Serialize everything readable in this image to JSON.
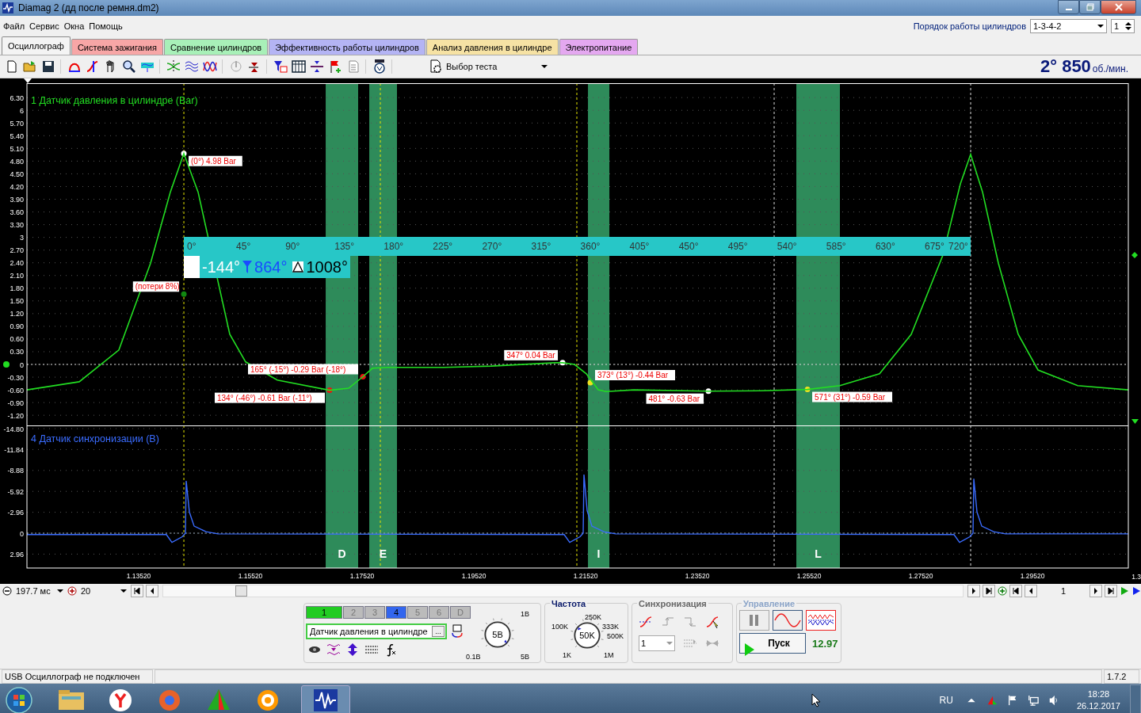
{
  "window": {
    "title": "Diamag 2 (дд после ремня.dm2)"
  },
  "menu": [
    "Файл",
    "Сервис",
    "Окна",
    "Помощь"
  ],
  "cylinder_order": {
    "label": "Порядок работы цилиндров",
    "value": "1-3-4-2",
    "spin_value": "1"
  },
  "tabs": [
    {
      "label": "Осциллограф",
      "selected": true,
      "color": "#f4f4f4"
    },
    {
      "label": "Система зажигания",
      "selected": false,
      "color": "#f7a6a6"
    },
    {
      "label": "Сравнение цилиндров",
      "selected": false,
      "color": "#a8f0b8"
    },
    {
      "label": "Эффективность работы цилиндров",
      "selected": false,
      "color": "#b4b4f4"
    },
    {
      "label": "Анализ давления в цилиндре",
      "selected": false,
      "color": "#f6e2a4"
    },
    {
      "label": "Электропитание",
      "selected": false,
      "color": "#e4a8f0"
    }
  ],
  "toolbar": {
    "test_select": "Выбор теста",
    "angle": "2°",
    "rpm": "850",
    "rpm_unit": "об./мин."
  },
  "scope": {
    "pressure": {
      "chart_data": {
        "type": "line",
        "title": "1 Датчик давления в цилиндре (Bar)",
        "xlim": [
          1.1152,
          1.31236
        ],
        "ylim": [
          -1.44,
          6.64
        ],
        "grid": true,
        "x": [
          1.1152,
          1.12456,
          1.13165,
          1.13733,
          1.14087,
          1.14329,
          1.14584,
          1.1473,
          1.15151,
          1.15435,
          1.16002,
          1.16938,
          1.17279,
          1.17534,
          1.17704,
          1.17988,
          1.18981,
          1.19832,
          1.20967,
          1.21109,
          1.21321,
          1.21534,
          1.21747,
          1.21889,
          1.22385,
          1.23719,
          1.24655,
          1.25492,
          1.26073,
          1.26782,
          1.2735,
          1.27917,
          1.28229,
          1.28414,
          1.28626,
          1.2891,
          1.29265,
          1.29619,
          1.30329,
          1.31236
        ],
        "series": [
          {
            "color": "#22dd22",
            "values": [
              -0.6,
              -0.41,
              0.34,
              2.39,
              4.07,
              4.98,
              4.07,
              3.2,
              0.71,
              0.06,
              -0.37,
              -0.61,
              -0.56,
              -0.29,
              -0.09,
              -0.07,
              -0.07,
              -0.04,
              0.04,
              0.04,
              0,
              -0.22,
              -0.6,
              -0.64,
              -0.6,
              -0.63,
              -0.62,
              -0.59,
              -0.5,
              -0.22,
              0.71,
              2.58,
              4.26,
              4.96,
              4.07,
              2.39,
              0.71,
              -0.13,
              -0.5,
              -0.6
            ]
          }
        ],
        "yticks": [
          {
            "value": 6.3,
            "label": "6.30"
          },
          {
            "value": 6,
            "label": "6"
          },
          {
            "value": 5.7,
            "label": "5.70"
          },
          {
            "value": 5.4,
            "label": "5.40"
          },
          {
            "value": 5.1,
            "label": "5.10"
          },
          {
            "value": 4.8,
            "label": "4.80"
          },
          {
            "value": 4.5,
            "label": "4.50"
          },
          {
            "value": 4.2,
            "label": "4.20"
          },
          {
            "value": 3.9,
            "label": "3.90"
          },
          {
            "value": 3.6,
            "label": "3.60"
          },
          {
            "value": 3.3,
            "label": "3.30"
          },
          {
            "value": 3,
            "label": "3"
          },
          {
            "value": 2.7,
            "label": "2.70"
          },
          {
            "value": 2.4,
            "label": "2.40"
          },
          {
            "value": 2.1,
            "label": "2.10"
          },
          {
            "value": 1.8,
            "label": "1.80"
          },
          {
            "value": 1.5,
            "label": "1.50"
          },
          {
            "value": 1.2,
            "label": "1.20"
          },
          {
            "value": 0.9,
            "label": "0.90"
          },
          {
            "value": 0.6,
            "label": "0.60"
          },
          {
            "value": 0.3,
            "label": "0.30"
          },
          {
            "value": 0,
            "label": "0"
          },
          {
            "value": -0.3,
            "label": "-0.30"
          },
          {
            "value": -0.6,
            "label": "-0.60"
          },
          {
            "value": -0.9,
            "label": "-0.90"
          },
          {
            "value": -1.2,
            "label": "-1.20"
          }
        ],
        "bands": [
          {
            "axis": "x",
            "from": 1.16868,
            "to": 1.17449
          },
          {
            "axis": "x",
            "from": 1.17648,
            "to": 1.18144
          },
          {
            "axis": "x",
            "from": 1.21563,
            "to": 1.21946
          },
          {
            "axis": "x",
            "from": 1.25293,
            "to": 1.26073
          }
        ],
        "ref_lines": [
          {
            "axis": "x",
            "value": 1.14329,
            "color": "#e6e600"
          },
          {
            "axis": "x",
            "value": 1.17846,
            "color": "#e6e600"
          },
          {
            "axis": "x",
            "value": 1.21364,
            "color": "#e6e600"
          },
          {
            "axis": "x",
            "value": 1.24896,
            "color": "#dddddd"
          },
          {
            "axis": "x",
            "value": 1.28414,
            "color": "#dddddd"
          },
          {
            "axis": "y",
            "value": 0,
            "color": "#dddddd"
          }
        ],
        "annotations": [
          {
            "x": 1.14329,
            "y": 4.98,
            "text": "(0°) 4.98 Bar"
          },
          {
            "x": 1.14329,
            "y": 1.66,
            "text": "(потери 8%)"
          },
          {
            "x": 1.17534,
            "y": -0.29,
            "text": "165° (-15°) -0.29 Bar (-18°)"
          },
          {
            "x": 1.16938,
            "y": -0.61,
            "text": "134° (-46°) -0.61 Bar (-11°)"
          },
          {
            "x": 1.21109,
            "y": 0.04,
            "text": "347° 0.04 Bar"
          },
          {
            "x": 1.21605,
            "y": -0.43,
            "text": "373° (13°) -0.44 Bar"
          },
          {
            "x": 1.23719,
            "y": -0.63,
            "text": "481° -0.63 Bar"
          },
          {
            "x": 1.25492,
            "y": -0.59,
            "text": "571° (31°) -0.59 Bar"
          }
        ]
      }
    },
    "sync": {
      "chart_data": {
        "type": "line",
        "title": "4 Датчик синхронизации (В)",
        "xlim": [
          1.1152,
          1.31236
        ],
        "ylim": [
          4.93,
          -15.25
        ],
        "grid": true,
        "x": [
          1.1152,
          1.14017,
          1.14116,
          1.143,
          1.14357,
          1.14371,
          1.14428,
          1.14513,
          1.14726,
          1.14938,
          1.21137,
          1.21236,
          1.21421,
          1.21477,
          1.21492,
          1.21548,
          1.21634,
          1.21846,
          1.22059,
          1.28116,
          1.28215,
          1.28399,
          1.28456,
          1.2847,
          1.28527,
          1.28612,
          1.28825,
          1.29038,
          1.31236
        ],
        "series": [
          {
            "color": "#3a6cff",
            "values": [
              0.2,
              0.2,
              1.3,
              0.5,
              0,
              -7.4,
              -3,
              -1,
              -0.2,
              0.1,
              0.2,
              1.3,
              0.5,
              0,
              -8.3,
              -3.2,
              -1,
              -0.2,
              0.1,
              0.2,
              1.3,
              0.5,
              0,
              -7.7,
              -3,
              -1,
              -0.2,
              0.1,
              0.1
            ]
          }
        ],
        "yticks": [
          {
            "value": -14.8,
            "label": "-14.80"
          },
          {
            "value": -11.84,
            "label": "-11.84"
          },
          {
            "value": -8.88,
            "label": "-8.88"
          },
          {
            "value": -5.92,
            "label": "-5.92"
          },
          {
            "value": -2.96,
            "label": "-2.96"
          },
          {
            "value": 0,
            "label": "0"
          },
          {
            "value": 2.96,
            "label": "2.96"
          }
        ],
        "xticks": [
          {
            "value": 1.1352,
            "label": "1.13520"
          },
          {
            "value": 1.1552,
            "label": "1.15520"
          },
          {
            "value": 1.1752,
            "label": "1.17520"
          },
          {
            "value": 1.1952,
            "label": "1.19520"
          },
          {
            "value": 1.2152,
            "label": "1.21520"
          },
          {
            "value": 1.2352,
            "label": "1.23520"
          },
          {
            "value": 1.2552,
            "label": "1.25520"
          },
          {
            "value": 1.2752,
            "label": "1.27520"
          },
          {
            "value": 1.2952,
            "label": "1.29520"
          }
        ],
        "bands": [
          {
            "axis": "x",
            "from": 1.16868,
            "to": 1.17449,
            "label": "D"
          },
          {
            "axis": "x",
            "from": 1.17648,
            "to": 1.18144,
            "label": "E"
          },
          {
            "axis": "x",
            "from": 1.21563,
            "to": 1.21946,
            "label": "I"
          },
          {
            "axis": "x",
            "from": 1.25293,
            "to": 1.26073,
            "label": "L"
          }
        ],
        "ref_lines": [
          {
            "axis": "x",
            "value": 1.14329,
            "color": "#e6e600"
          },
          {
            "axis": "x",
            "value": 1.17846,
            "color": "#e6e600"
          },
          {
            "axis": "x",
            "value": 1.21364,
            "color": "#e6e600"
          },
          {
            "axis": "x",
            "value": 1.24896,
            "color": "#dddddd"
          },
          {
            "axis": "x",
            "value": 1.28414,
            "color": "#dddddd"
          },
          {
            "axis": "y",
            "value": 0,
            "color": "#99aabb"
          }
        ]
      }
    },
    "edge_label": "1.3",
    "ruler": [
      "0°",
      "45°",
      "90°",
      "135°",
      "180°",
      "225°",
      "270°",
      "315°",
      "360°",
      "405°",
      "450°",
      "495°",
      "540°",
      "585°",
      "630°",
      "675°",
      "720°"
    ],
    "readout": {
      "start": "-144°",
      "end": "864°",
      "span": "1008°"
    }
  },
  "timebase": {
    "time_per_div": "197.7 мс",
    "zoom": "20",
    "frame": "1"
  },
  "panel": {
    "channels": [
      {
        "label": "1",
        "on": true
      },
      {
        "label": "2",
        "on": false
      },
      {
        "label": "3",
        "on": false
      },
      {
        "label": "4",
        "on": true
      },
      {
        "label": "5",
        "on": false
      },
      {
        "label": "6",
        "on": false
      },
      {
        "label": "D",
        "on": false
      }
    ],
    "sensor": "Датчик давления в цилиндре",
    "more": "...",
    "volt_knob": {
      "value": "5В",
      "labels": [
        "1В",
        "0.1В",
        "5В"
      ]
    },
    "freq_title": "Частота",
    "freq_knob": {
      "value": "50K",
      "labels": [
        "100K",
        "250K",
        "333K",
        "500K",
        "1K",
        "1M"
      ]
    },
    "sync_title": "Синхронизация",
    "sync_channel": "1",
    "control_title": "Управление",
    "start": "Пуск",
    "reading": "12.97"
  },
  "status_bar": {
    "message": "USB Осциллограф не подключен",
    "version": "1.7.2"
  },
  "taskbar": {
    "language": "RU",
    "time": "18:28",
    "date": "26.12.2017"
  }
}
